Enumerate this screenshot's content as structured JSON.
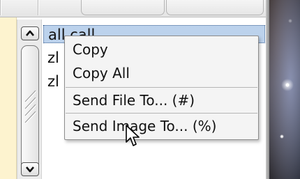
{
  "list": {
    "items": [
      {
        "label": "all call"
      },
      {
        "label": "zl"
      },
      {
        "label": "zl"
      }
    ]
  },
  "context_menu": {
    "items": [
      {
        "label": "Copy"
      },
      {
        "label": "Copy All"
      },
      {
        "label": "Send File To... (#)"
      },
      {
        "label": "Send Image To... (%)"
      }
    ]
  },
  "icons": {
    "scroll_up": "chevron-up-icon",
    "scroll_down": "chevron-down-icon",
    "cursor": "mouse-pointer-icon"
  }
}
